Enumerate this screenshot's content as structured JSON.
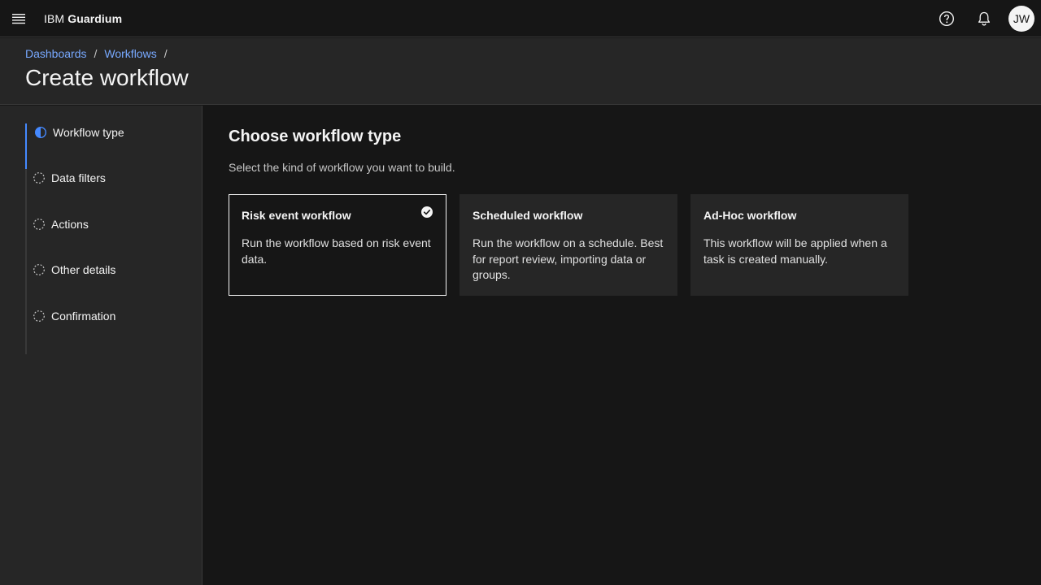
{
  "header": {
    "brand_prefix": "IBM",
    "brand_name": "Guardium",
    "avatar_initials": "JW",
    "icons": [
      "menu-icon",
      "help-icon",
      "notification-icon"
    ]
  },
  "breadcrumb": {
    "items": [
      "Dashboards",
      "Workflows"
    ],
    "separator": "/"
  },
  "page": {
    "title": "Create workflow"
  },
  "steps": [
    {
      "label": "Workflow type",
      "state": "current"
    },
    {
      "label": "Data filters",
      "state": "incomplete"
    },
    {
      "label": "Actions",
      "state": "incomplete"
    },
    {
      "label": "Other details",
      "state": "incomplete"
    },
    {
      "label": "Confirmation",
      "state": "incomplete"
    }
  ],
  "main": {
    "heading": "Choose workflow type",
    "description": "Select the kind of workflow you want to build.",
    "cards": [
      {
        "title": "Risk event workflow",
        "description": "Run the workflow based on risk event data.",
        "selected": true
      },
      {
        "title": "Scheduled workflow",
        "description": "Run the workflow on a schedule. Best for report review, importing data or groups.",
        "selected": false
      },
      {
        "title": "Ad-Hoc workflow",
        "description": "This workflow will be applied when a task is created manually.",
        "selected": false
      }
    ]
  },
  "colors": {
    "background": "#161616",
    "surface": "#262626",
    "link": "#78a9ff",
    "accent": "#4589ff",
    "text": "#f4f4f4"
  }
}
